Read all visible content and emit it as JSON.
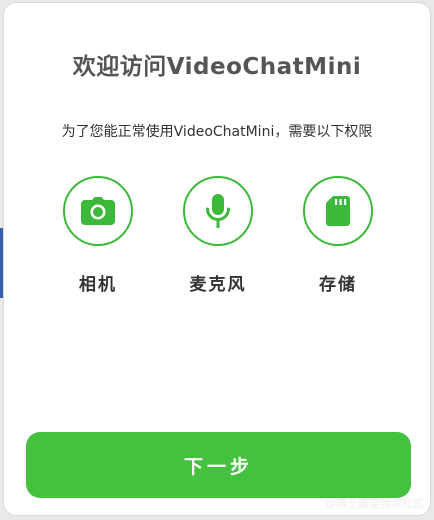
{
  "dialog": {
    "title": "欢迎访问VideoChatMini",
    "subtitle": "为了您能正常使用VideoChatMini，需要以下权限",
    "accent_color": "#3cb83a",
    "permissions": [
      {
        "icon": "camera-icon",
        "label": "相机"
      },
      {
        "icon": "microphone-icon",
        "label": "麦克风"
      },
      {
        "icon": "sd-card-icon",
        "label": "存储"
      }
    ],
    "next_button": {
      "label": "下一步",
      "color": "#44c13f"
    }
  },
  "watermark": "@稀土掘金技术社区"
}
